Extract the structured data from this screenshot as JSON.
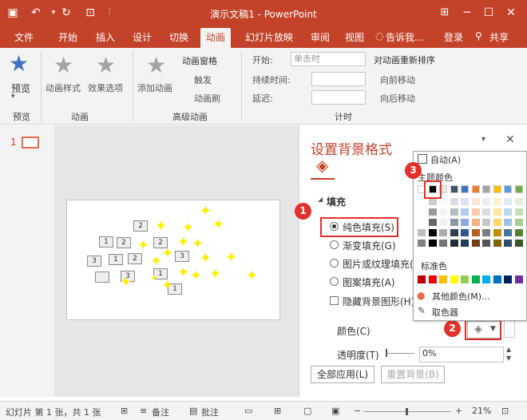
{
  "window": {
    "title": "演示文稿1 - PowerPoint",
    "tabs": [
      "文件",
      "开始",
      "插入",
      "设计",
      "切换",
      "动画",
      "幻灯片放映",
      "审阅",
      "视图"
    ],
    "tell_me": "告诉我...",
    "login": "登录",
    "share": "共享"
  },
  "ribbon": {
    "preview_label": "预览",
    "preview_group": "预览",
    "anim_style": "动画样式",
    "effect_options": "效果选项",
    "anim_group": "动画",
    "add_anim": "添加动画",
    "anim_pane": "动画窗格",
    "trigger": "触发",
    "anim_brush": "动画刷",
    "adv_group": "高级动画",
    "start_label": "开始:",
    "start_value": "单击时",
    "duration_label": "持续时间:",
    "delay_label": "延迟:",
    "timing_group": "计时",
    "reorder_label": "对动画重新排序",
    "move_earlier": "向前移动",
    "move_later": "向后移动"
  },
  "thumbnail": {
    "number": "1"
  },
  "format_pane": {
    "title": "设置背景格式",
    "section": "填充",
    "options": [
      "纯色填充(S)",
      "渐变填充(G)",
      "图片或纹理填充(P)",
      "图案填充(A)"
    ],
    "hide_bg": "隐藏背景图形(H)",
    "color_label": "颜色(C)",
    "transparency_label": "透明度(T)",
    "transparency_value": "0%",
    "apply_all": "全部应用(L)",
    "reset_bg": "重置背景(B)"
  },
  "color_popup": {
    "automatic": "自动(A)",
    "theme_colors": "主题颜色",
    "standard_colors": "标准色",
    "more_colors": "其他颜色(M)...",
    "eyedropper": "取色器",
    "theme_top": [
      "#ffffff",
      "#000000",
      "#e7e6e6",
      "#44546a",
      "#4472c4",
      "#ed7d31",
      "#a5a5a5",
      "#ffc000",
      "#5b9bd5",
      "#70ad47"
    ],
    "standard": [
      "#c00000",
      "#ff0000",
      "#ffc000",
      "#ffff00",
      "#92d050",
      "#00b050",
      "#00b0f0",
      "#0070c0",
      "#002060",
      "#7030a0"
    ]
  },
  "badges": [
    "1",
    "2",
    "3"
  ],
  "slide_numbers": [
    "2",
    "1",
    "2",
    "2",
    "3",
    "1",
    "2",
    "3",
    "3",
    "1",
    "1"
  ],
  "status": {
    "slide_info": "幻灯片 第 1 张，共 1 张",
    "notes": "备注",
    "comments": "批注",
    "zoom": "21%"
  },
  "colors": {
    "accent": "#c3432a",
    "highlight": "#e0312c"
  }
}
